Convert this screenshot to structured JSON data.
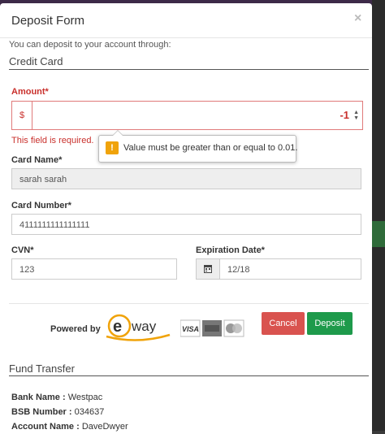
{
  "modal": {
    "title": "Deposit Form",
    "close_label": "×",
    "intro": "You can deposit to your account through:"
  },
  "credit_card": {
    "section_title": "Credit Card",
    "amount": {
      "label": "Amount*",
      "currency": "$",
      "value": "-1",
      "error": "This field is required.",
      "tooltip": "Value must be greater than or equal to 0.01."
    },
    "card_name": {
      "label": "Card Name*",
      "value": "sarah sarah"
    },
    "card_number": {
      "label": "Card Number*",
      "value": "4111111111111111"
    },
    "cvn": {
      "label": "CVN*",
      "value": "123"
    },
    "expiration": {
      "label": "Expiration Date*",
      "value": "12/18"
    }
  },
  "footer": {
    "powered_by": "Powered by",
    "eway_logo_text": "eway",
    "card_logos": [
      "VISA",
      "AMERICAN EXPRESS",
      "Mastercard"
    ],
    "cancel_label": "Cancel",
    "deposit_label": "Deposit"
  },
  "fund_transfer": {
    "section_title": "Fund Transfer",
    "bank_name_label": "Bank Name :",
    "bank_name_value": "Westpac",
    "bsb_label": "BSB Number :",
    "bsb_value": "034637",
    "account_name_label": "Account Name :",
    "account_name_value": "DaveDwyer"
  },
  "colors": {
    "error": "#c9302c",
    "cancel": "#d9534f",
    "deposit": "#1e9a4b",
    "warning": "#f0a30a"
  }
}
